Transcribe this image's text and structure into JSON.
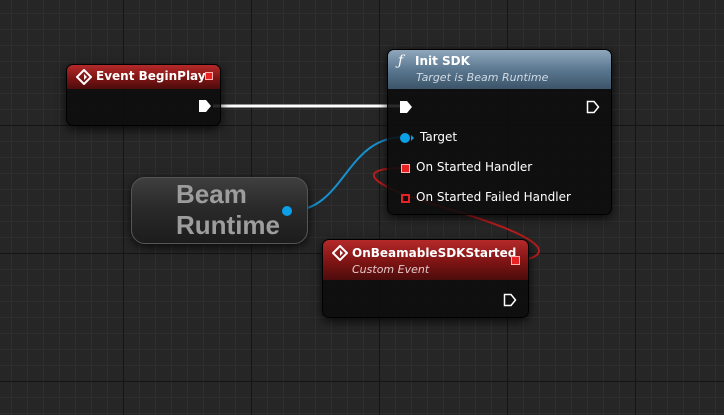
{
  "colors": {
    "exec": "#ffffff",
    "object_pin": "#0a9fe6",
    "delegate_pin": "#e82222",
    "event_header": "#8b1a1a",
    "function_header": "#5b7891"
  },
  "nodes": {
    "begin_play": {
      "title": "Event BeginPlay",
      "icon": "event-diamond-icon"
    },
    "init_sdk": {
      "title": "Init SDK",
      "subtitle": "Target is Beam Runtime",
      "icon": "function-icon",
      "pins": {
        "target": "Target",
        "on_started": "On Started Handler",
        "on_failed": "On Started Failed Handler"
      }
    },
    "beam_runtime": {
      "line1": "Beam",
      "line2": "Runtime"
    },
    "on_started_event": {
      "title": "OnBeamableSDKStarted",
      "subtitle": "Custom Event",
      "icon": "event-diamond-icon"
    }
  }
}
